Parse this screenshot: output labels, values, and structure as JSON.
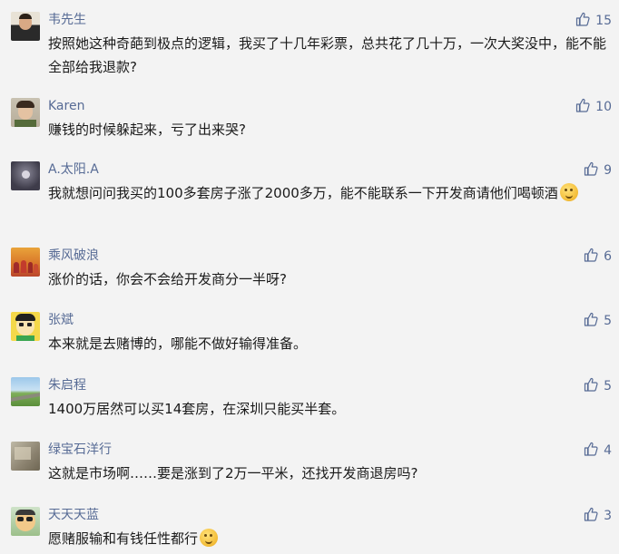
{
  "comments": [
    {
      "name": "韦先生",
      "content": "按照她这种奇葩到极点的逻辑，我买了十几年彩票，总共花了几十万，一次大奖没中，能不能全部给我退款?",
      "likes": "15",
      "emoji": false
    },
    {
      "name": "Karen",
      "content": "赚钱的时候躲起来，亏了出来哭?",
      "likes": "10",
      "emoji": false
    },
    {
      "name": "A.太阳.A",
      "content": "我就想问问我买的100多套房子涨了2000多万，能不能联系一下开发商请他们喝顿酒",
      "likes": "9",
      "emoji": true
    },
    {
      "name": "乘风破浪",
      "content": "涨价的话，你会不会给开发商分一半呀?",
      "likes": "6",
      "emoji": false
    },
    {
      "name": "张斌",
      "content": "本来就是去赌博的，哪能不做好输得准备。",
      "likes": "5",
      "emoji": false
    },
    {
      "name": "朱启程",
      "content": "1400万居然可以买14套房，在深圳只能买半套。",
      "likes": "5",
      "emoji": false
    },
    {
      "name": "绿宝石洋行",
      "content": "这就是市场啊……要是涨到了2万一平米，还找开发商退房吗?",
      "likes": "4",
      "emoji": false
    },
    {
      "name": "天天天蓝",
      "content": "愿赌服输和有钱任性都行",
      "likes": "3",
      "emoji": true
    }
  ],
  "colors": {
    "name": "#576b95",
    "text": "#1a1a1a",
    "background": "#f3f3f3",
    "like": "#576b95"
  },
  "icons": {
    "like": "thumbs-up-icon",
    "emoji": "thinking-face-icon"
  }
}
